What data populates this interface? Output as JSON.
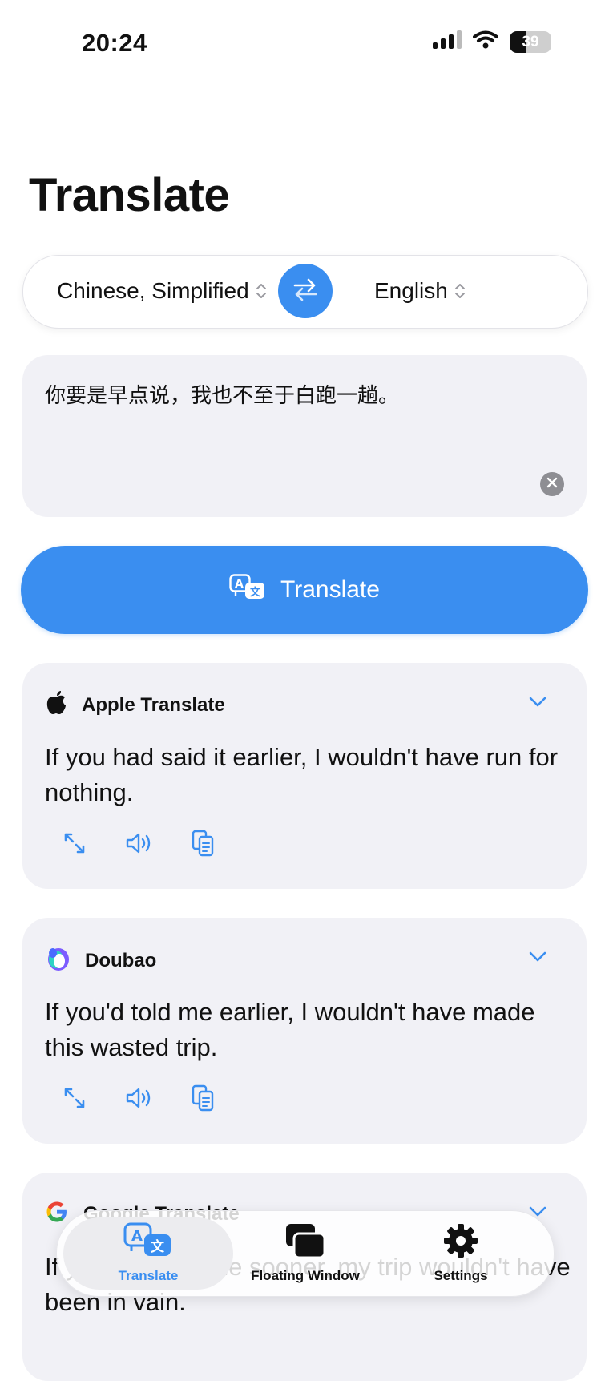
{
  "status_bar": {
    "time": "20:24",
    "battery": "39"
  },
  "title": "Translate",
  "languages": {
    "source": "Chinese, Simplified",
    "target": "English"
  },
  "input": {
    "text": "你要是早点说，我也不至于白跑一趟。"
  },
  "translate_button": {
    "label": "Translate"
  },
  "results": [
    {
      "provider": "Apple Translate",
      "icon": "apple-logo-icon",
      "text": "If you had said it earlier, I wouldn't have run for nothing."
    },
    {
      "provider": "Doubao",
      "icon": "doubao-logo-icon",
      "text": "If you'd told me earlier, I wouldn't have made this wasted trip."
    },
    {
      "provider": "Google Translate",
      "icon": "google-logo-icon",
      "text": "If you had told me sooner, my trip wouldn't have been in vain."
    }
  ],
  "tabbar": {
    "tabs": [
      {
        "label": "Translate",
        "icon": "translate-icon",
        "active": true
      },
      {
        "label": "Floating Window",
        "icon": "floating-window-icon",
        "active": false
      },
      {
        "label": "Settings",
        "icon": "gear-icon",
        "active": false
      }
    ]
  },
  "colors": {
    "accent": "#3a8ef0",
    "card_bg": "#f1f1f6"
  }
}
